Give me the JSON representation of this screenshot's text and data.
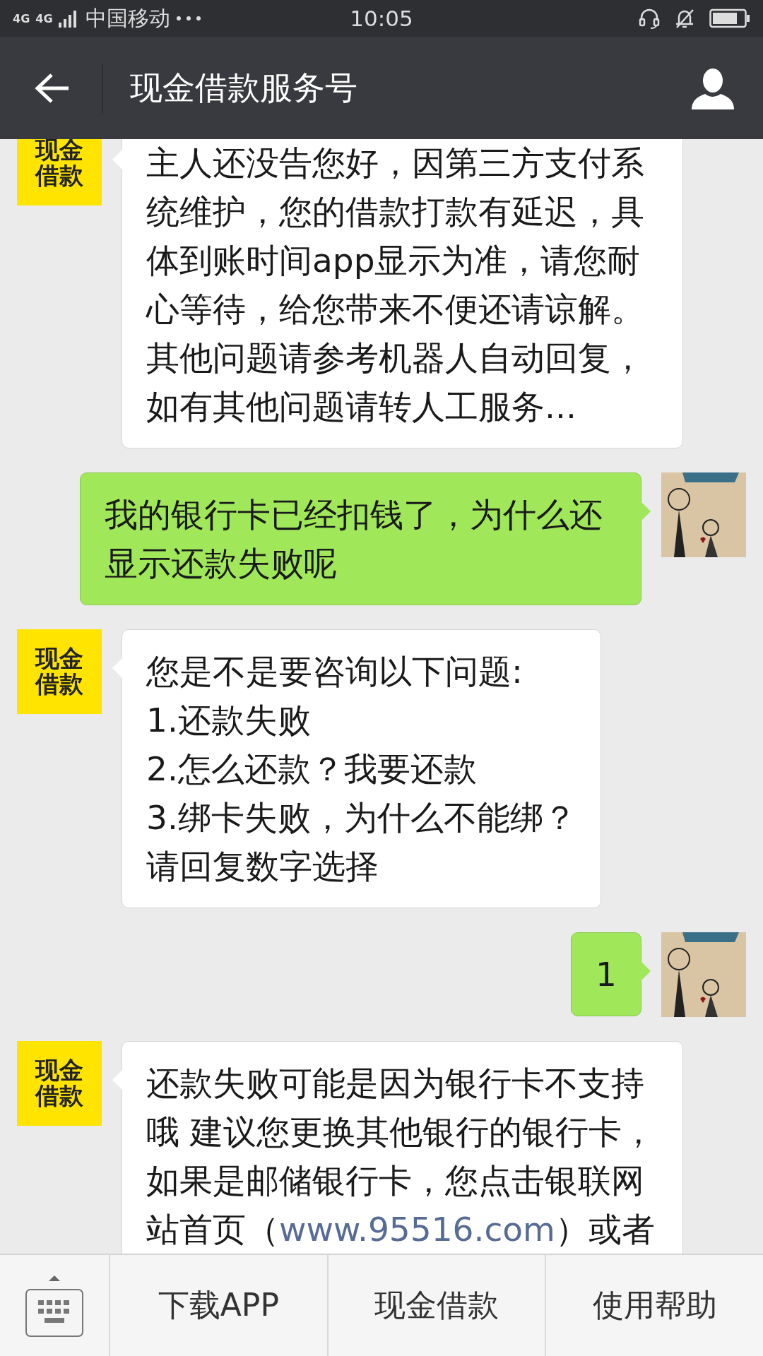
{
  "status_bar": {
    "network": [
      "4G",
      "4G"
    ],
    "carrier": "中国移动",
    "time": "10:05"
  },
  "header": {
    "title": "现金借款服务号"
  },
  "messages": [
    {
      "kind": "incoming",
      "avatar_text": "现金借款",
      "parts": [
        {
          "kind": "text",
          "text": "主人还没告您好，因第三方支付系统维护，您的借款打款有延迟，具体到账时间app显示为准，请您耐心等待，给您带来不便还请谅解。其他问题请参考机器人自动回复，如有其他问题请转人工服务..."
        }
      ]
    },
    {
      "kind": "outgoing",
      "parts": [
        {
          "kind": "text",
          "text": "我的银行卡已经扣钱了，为什么还显示还款失败呢"
        }
      ]
    },
    {
      "kind": "incoming",
      "avatar_text": "现金借款",
      "parts": [
        {
          "kind": "line",
          "text": "您是不是要咨询以下问题:"
        },
        {
          "kind": "line",
          "text": "1.还款失败"
        },
        {
          "kind": "line",
          "text": "2.怎么还款？我要还款"
        },
        {
          "kind": "line",
          "text": "3.绑卡失败，为什么不能绑？"
        },
        {
          "kind": "line",
          "text": "请回复数字选择"
        }
      ]
    },
    {
      "kind": "outgoing",
      "parts": [
        {
          "kind": "text",
          "text": "1"
        }
      ]
    },
    {
      "kind": "incoming",
      "avatar_text": "现金借款",
      "parts": [
        {
          "kind": "text",
          "text": "还款失败可能是因为银行卡不支持哦 建议您更换其他银行的银行卡，如果是邮储银行卡，您点击银联网站首页（"
        },
        {
          "kind": "link",
          "text": "www.95516.com"
        },
        {
          "kind": "text",
          "text": "）或者"
        }
      ]
    }
  ],
  "menu": {
    "items": [
      "下载APP",
      "现金借款",
      "使用帮助"
    ]
  }
}
